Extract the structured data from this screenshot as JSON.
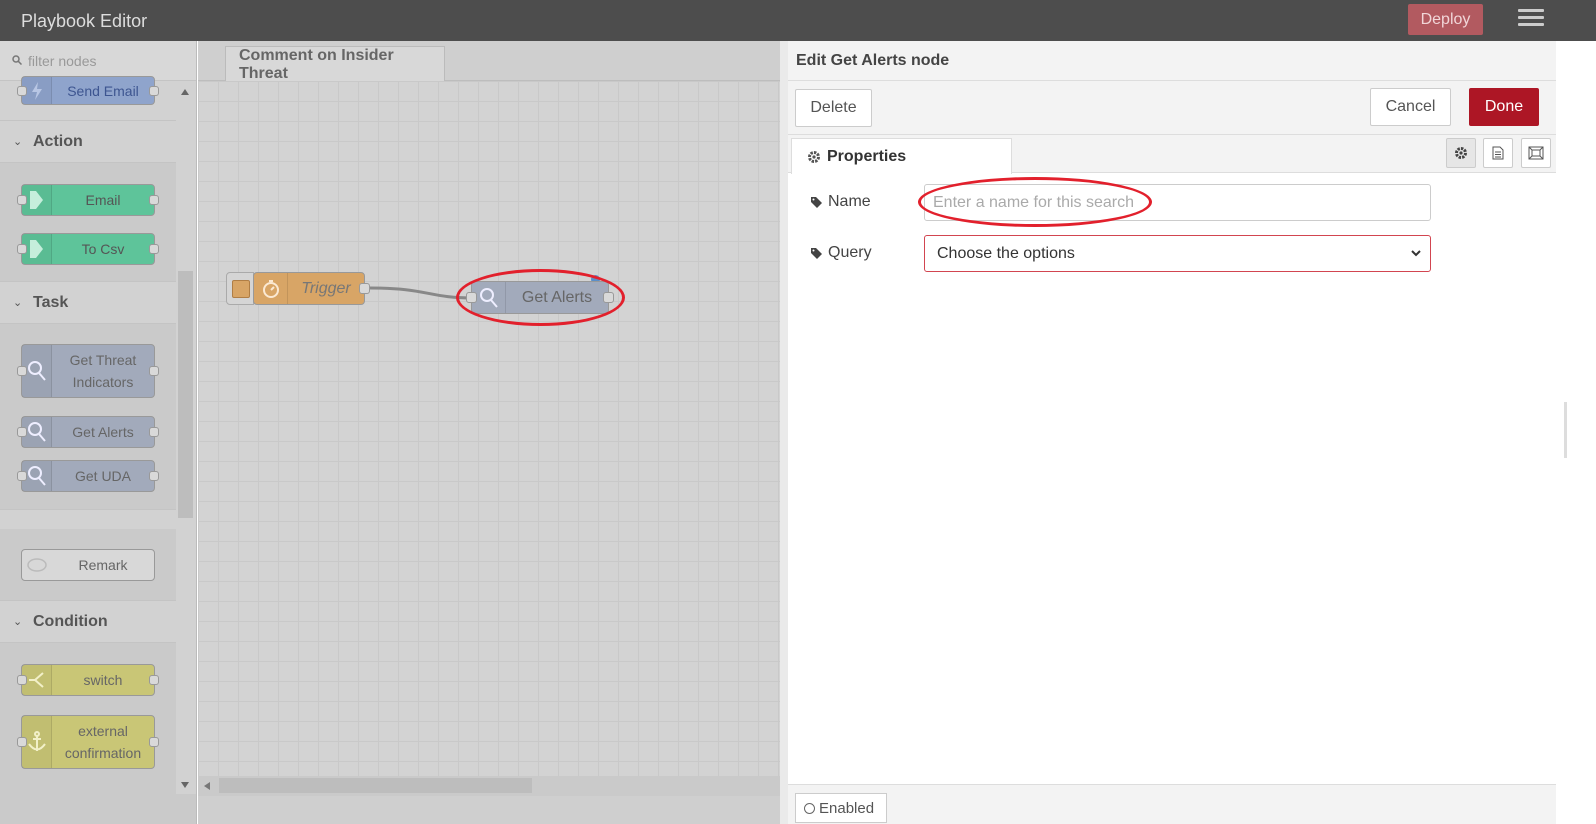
{
  "header": {
    "title": "Playbook Editor",
    "deploy_label": "Deploy"
  },
  "palette": {
    "filter_placeholder": "filter nodes",
    "top_node": "Send Email",
    "categories": {
      "action": "Action",
      "task": "Task",
      "condition": "Condition"
    },
    "action_nodes": [
      "Email",
      "To Csv"
    ],
    "task_nodes": [
      "Get Threat Indicators",
      "Get Alerts",
      "Get UDA"
    ],
    "misc_nodes": [
      "Remark"
    ],
    "condition_nodes": [
      "switch",
      "external confirmation"
    ]
  },
  "workspace": {
    "tab_label": "Comment on Insider Threat",
    "nodes": {
      "trigger": "Trigger",
      "get_alerts": "Get Alerts"
    }
  },
  "editor": {
    "title": "Edit Get Alerts node",
    "delete_label": "Delete",
    "cancel_label": "Cancel",
    "done_label": "Done",
    "properties_tab": "Properties",
    "name_label": "Name",
    "name_placeholder": "Enter a name for this search",
    "name_value": "",
    "query_label": "Query",
    "query_value": "Choose the options",
    "enabled_label": "Enabled"
  },
  "colors": {
    "header_bg": "#4d4d4d",
    "deploy_bg": "#b25a60",
    "done_bg": "#ad1625",
    "highlight": "#e2202c",
    "action_node": "#5ec49a",
    "task_node": "#a2aabb",
    "trigger_node": "#d8a566",
    "condition_node": "#c9c676"
  }
}
